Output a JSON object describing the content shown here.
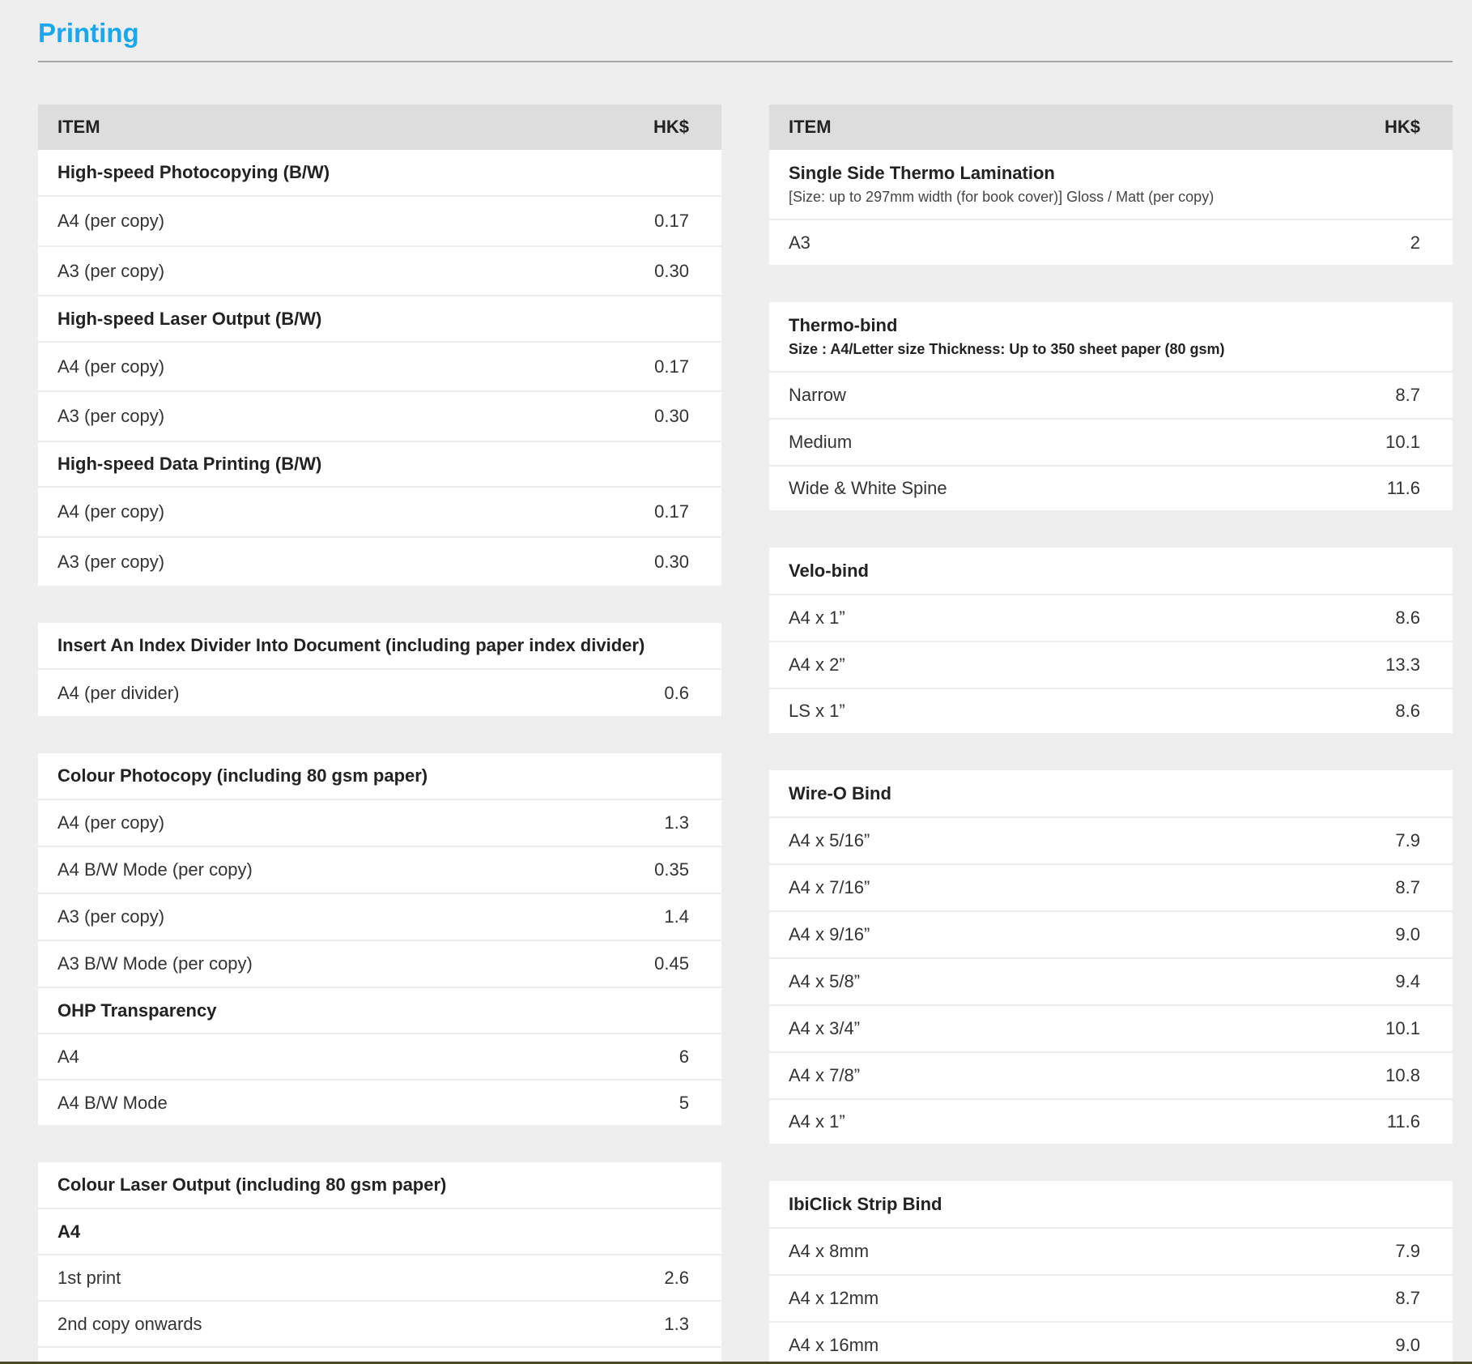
{
  "page": {
    "title": "Printing"
  },
  "header": {
    "item": "ITEM",
    "price": "HK$"
  },
  "left": {
    "bw": {
      "g1": {
        "title": "High-speed Photocopying (B/W)",
        "rows": [
          [
            "A4 (per copy)",
            "0.17"
          ],
          [
            "A3 (per copy)",
            "0.30"
          ]
        ]
      },
      "g2": {
        "title": "High-speed Laser Output (B/W)",
        "rows": [
          [
            "A4 (per copy)",
            "0.17"
          ],
          [
            "A3 (per copy)",
            "0.30"
          ]
        ]
      },
      "g3": {
        "title": "High-speed Data Printing (B/W)",
        "rows": [
          [
            "A4 (per copy)",
            "0.17"
          ],
          [
            "A3 (per copy)",
            "0.30"
          ]
        ]
      }
    },
    "index": {
      "title": "Insert An Index Divider Into Document (including paper index divider)",
      "rows": [
        [
          "A4 (per divider)",
          "0.6"
        ]
      ]
    },
    "colour": {
      "title": "Colour Photocopy (including 80 gsm paper)",
      "rows": [
        [
          "A4 (per copy)",
          "1.3"
        ],
        [
          "A4 B/W Mode (per copy)",
          "0.35"
        ],
        [
          "A3 (per copy)",
          "1.4"
        ],
        [
          "A3 B/W Mode (per copy)",
          "0.45"
        ]
      ],
      "ohp_title": "OHP Transparency",
      "ohp_rows": [
        [
          "A4",
          "6"
        ],
        [
          "A4 B/W Mode",
          "5"
        ]
      ]
    },
    "laser": {
      "title": "Colour Laser Output (including 80 gsm paper)",
      "sub": "A4",
      "rows": [
        [
          "1st print",
          "2.6"
        ],
        [
          "2nd copy onwards",
          "1.3"
        ]
      ]
    }
  },
  "right": {
    "lamination": {
      "title": "Single Side Thermo Lamination",
      "note": "[Size: up to 297mm width (for book cover)] Gloss / Matt (per copy)",
      "rows": [
        [
          "A3",
          "2"
        ]
      ]
    },
    "thermo": {
      "title": "Thermo-bind",
      "note": "Size : A4/Letter size Thickness: Up to 350 sheet paper (80 gsm)",
      "rows": [
        [
          "Narrow",
          "8.7"
        ],
        [
          "Medium",
          "10.1"
        ],
        [
          "Wide & White Spine",
          "11.6"
        ]
      ]
    },
    "velo": {
      "title": "Velo-bind",
      "rows": [
        [
          "A4 x 1”",
          "8.6"
        ],
        [
          "A4 x 2”",
          "13.3"
        ],
        [
          "LS x 1”",
          "8.6"
        ]
      ]
    },
    "wireo": {
      "title": "Wire-O Bind",
      "rows": [
        [
          "A4 x 5/16”",
          "7.9"
        ],
        [
          "A4 x 7/16”",
          "8.7"
        ],
        [
          "A4 x 9/16”",
          "9.0"
        ],
        [
          "A4 x 5/8”",
          "9.4"
        ],
        [
          "A4 x 3/4”",
          "10.1"
        ],
        [
          "A4 x 7/8”",
          "10.8"
        ],
        [
          "A4 x 1”",
          "11.6"
        ]
      ]
    },
    "ibiclick": {
      "title": "IbiClick Strip Bind",
      "rows": [
        [
          "A4 x 8mm",
          "7.9"
        ],
        [
          "A4 x 12mm",
          "8.7"
        ],
        [
          "A4 x 16mm",
          "9.0"
        ]
      ]
    }
  }
}
